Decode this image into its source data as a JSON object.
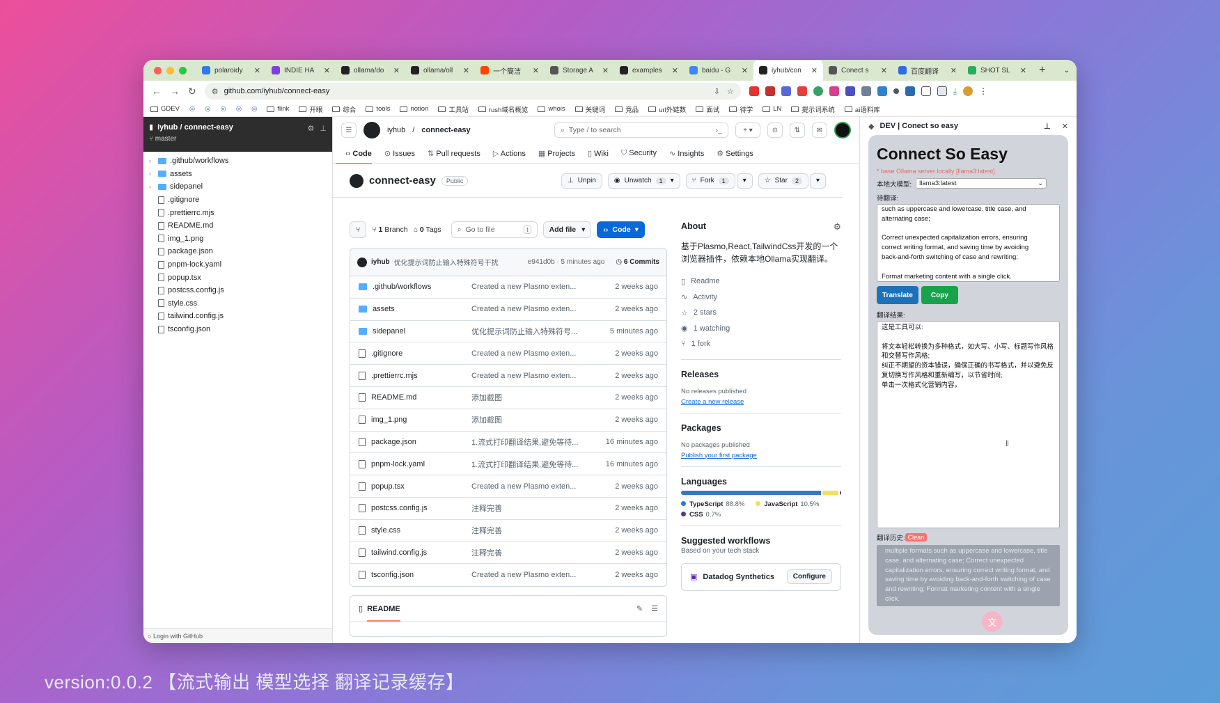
{
  "tabs": [
    {
      "label": "polaroidy",
      "color": "#2f7ae5"
    },
    {
      "label": "INDIE HA",
      "color": "#7b3fe4"
    },
    {
      "label": "ollama/do",
      "color": "#222222"
    },
    {
      "label": "ollama/oll",
      "color": "#222222"
    },
    {
      "label": "一个簡洁",
      "color": "#ff4500"
    },
    {
      "label": "Storage A",
      "color": "#555555"
    },
    {
      "label": "examples",
      "color": "#222222"
    },
    {
      "label": "baidu - G",
      "color": "#4285f4"
    },
    {
      "label": "iyhub/con",
      "color": "#222222"
    },
    {
      "label": "Conect s",
      "color": "#555555"
    },
    {
      "label": "百度翻译",
      "color": "#2f6be4"
    },
    {
      "label": "SHOT SL",
      "color": "#2bab5f"
    }
  ],
  "address": "github.com/iyhub/connect-easy",
  "bookmarks": [
    "GDEV",
    "flink",
    "开眼",
    "综合",
    "tools",
    "notion",
    "工具站",
    "rush域名概览",
    "whois",
    "关键词",
    "竞品",
    "url外链数",
    "面试",
    "待学",
    "LN",
    "提示词系统",
    "ai语料库"
  ],
  "tree": {
    "repo": "iyhub / connect-easy",
    "branch": "master",
    "items": [
      {
        "name": ".github/workflows",
        "type": "dir"
      },
      {
        "name": "assets",
        "type": "dir"
      },
      {
        "name": "sidepanel",
        "type": "dir"
      },
      {
        "name": ".gitignore",
        "type": "file"
      },
      {
        "name": ".prettierrc.mjs",
        "type": "file"
      },
      {
        "name": "README.md",
        "type": "file"
      },
      {
        "name": "img_1.png",
        "type": "file"
      },
      {
        "name": "package.json",
        "type": "file"
      },
      {
        "name": "pnpm-lock.yaml",
        "type": "file"
      },
      {
        "name": "popup.tsx",
        "type": "file"
      },
      {
        "name": "postcss.config.js",
        "type": "file"
      },
      {
        "name": "style.css",
        "type": "file"
      },
      {
        "name": "tailwind.config.js",
        "type": "file"
      },
      {
        "name": "tsconfig.json",
        "type": "file"
      }
    ],
    "footer": "Login with GitHub"
  },
  "gh": {
    "owner": "iyhub",
    "repo": "connect-easy",
    "search": "Type / to search",
    "nav": [
      "Code",
      "Issues",
      "Pull requests",
      "Actions",
      "Projects",
      "Wiki",
      "Security",
      "Insights",
      "Settings"
    ],
    "visibility": "Public",
    "unpin": "Unpin",
    "unwatch": "Unwatch",
    "unwatch_count": "1",
    "fork": "Fork",
    "fork_count": "1",
    "star": "Star",
    "star_count": "2",
    "branch_count": "1",
    "branch_label": "Branch",
    "tags_count": "0",
    "tags_label": "Tags",
    "gofile": "Go to file",
    "gofile_key": "t",
    "addfile": "Add file",
    "code": "Code",
    "commit": {
      "author": "iyhub",
      "message": "优化提示词防止输入特殊符号干扰",
      "hash": "e941d0b · 5 minutes ago",
      "commits": "6 Commits"
    },
    "files": [
      {
        "name": ".github/workflows",
        "type": "dir",
        "msg": "Created a new Plasmo exten...",
        "date": "2 weeks ago"
      },
      {
        "name": "assets",
        "type": "dir",
        "msg": "Created a new Plasmo exten...",
        "date": "2 weeks ago"
      },
      {
        "name": "sidepanel",
        "type": "dir",
        "msg": "优化提示词防止输入特殊符号...",
        "date": "5 minutes ago"
      },
      {
        "name": ".gitignore",
        "type": "file",
        "msg": "Created a new Plasmo exten...",
        "date": "2 weeks ago"
      },
      {
        "name": ".prettierrc.mjs",
        "type": "file",
        "msg": "Created a new Plasmo exten...",
        "date": "2 weeks ago"
      },
      {
        "name": "README.md",
        "type": "file",
        "msg": "添加截图",
        "date": "2 weeks ago"
      },
      {
        "name": "img_1.png",
        "type": "file",
        "msg": "添加截图",
        "date": "2 weeks ago"
      },
      {
        "name": "package.json",
        "type": "file",
        "msg": "1.流式打印翻译结果,避免等待...",
        "date": "16 minutes ago"
      },
      {
        "name": "pnpm-lock.yaml",
        "type": "file",
        "msg": "1.流式打印翻译结果,避免等待...",
        "date": "16 minutes ago"
      },
      {
        "name": "popup.tsx",
        "type": "file",
        "msg": "Created a new Plasmo exten...",
        "date": "2 weeks ago"
      },
      {
        "name": "postcss.config.js",
        "type": "file",
        "msg": "注释完善",
        "date": "2 weeks ago"
      },
      {
        "name": "style.css",
        "type": "file",
        "msg": "注释完善",
        "date": "2 weeks ago"
      },
      {
        "name": "tailwind.config.js",
        "type": "file",
        "msg": "注释完善",
        "date": "2 weeks ago"
      },
      {
        "name": "tsconfig.json",
        "type": "file",
        "msg": "Created a new Plasmo exten...",
        "date": "2 weeks ago"
      }
    ],
    "readme": "README",
    "about": {
      "title": "About",
      "desc": "基于Plasmo,React,TailwindCss开发的一个浏览器插件，依赖本地Ollama实现翻译。",
      "meta": [
        "Readme",
        "Activity",
        "2 stars",
        "1 watching",
        "1 fork"
      ]
    },
    "releases": {
      "title": "Releases",
      "none": "No releases published",
      "link": "Create a new release"
    },
    "packages": {
      "title": "Packages",
      "none": "No packages published",
      "link": "Publish your first package"
    },
    "languages": {
      "title": "Languages",
      "items": [
        {
          "name": "TypeScript",
          "pct": "88.8%",
          "value": 88.8,
          "color": "#3178c6"
        },
        {
          "name": "JavaScript",
          "pct": "10.5%",
          "value": 10.5,
          "color": "#f1e05a"
        },
        {
          "name": "CSS",
          "pct": "0.7%",
          "value": 0.7,
          "color": "#563d7c"
        }
      ]
    },
    "workflows": {
      "title": "Suggested workflows",
      "sub": "Based on your tech stack",
      "name": "Datadog Synthetics",
      "btn": "Configure"
    }
  },
  "panel": {
    "title": "DEV | Conect so easy",
    "heading": "Connect So Easy",
    "note": "* base Ollama server locally [llama3:latest]",
    "model_label": "本地大模型:",
    "model": "llama3:latest",
    "input_label": "待翻译:",
    "input": "such as uppercase and lowercase, title case, and\nalternating case;\n\nCorrect unexpected capitalization errors, ensuring\ncorrect writing format, and saving time by avoiding\nback-and-forth switching of case and rewriting;\n\nFormat marketing content with a single click.",
    "translate": "Translate",
    "copy": "Copy",
    "result_label": "翻译结果:",
    "result": "这是工具可以:\n\n将文本轻松转换为多种格式，如大写、小写、标题写作风格和交替写作风格;\n纠正不期望的资本错误，确保正确的书写格式，并以避免反复切换写作风格和重新编写，以节省时间;\n单击一次格式化营销内容。",
    "history_label": "翻译历史:",
    "clean": "Clean",
    "history": "multiple formats such as uppercase and lowercase, title case, and alternating case; Correct unexpected capitalization errors, ensuring correct writing format, and saving time by avoiding back-and-forth switching of case and rewriting; Format marketing content with a single click."
  },
  "caption": "version:0.0.2 【流式输出 模型选择 翻译记录缓存】"
}
